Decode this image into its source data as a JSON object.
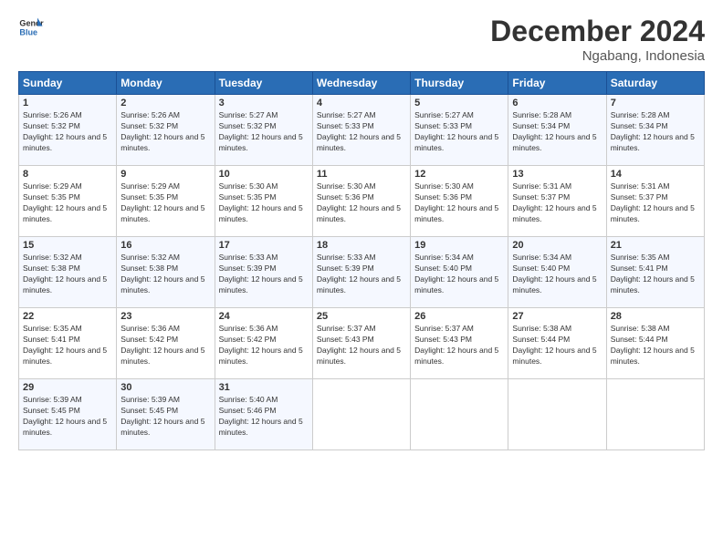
{
  "logo": {
    "line1": "General",
    "line2": "Blue"
  },
  "title": "December 2024",
  "location": "Ngabang, Indonesia",
  "days_of_week": [
    "Sunday",
    "Monday",
    "Tuesday",
    "Wednesday",
    "Thursday",
    "Friday",
    "Saturday"
  ],
  "weeks": [
    [
      {
        "day": "1",
        "sunrise": "5:26 AM",
        "sunset": "5:32 PM",
        "daylight": "12 hours and 5 minutes."
      },
      {
        "day": "2",
        "sunrise": "5:26 AM",
        "sunset": "5:32 PM",
        "daylight": "12 hours and 5 minutes."
      },
      {
        "day": "3",
        "sunrise": "5:27 AM",
        "sunset": "5:32 PM",
        "daylight": "12 hours and 5 minutes."
      },
      {
        "day": "4",
        "sunrise": "5:27 AM",
        "sunset": "5:33 PM",
        "daylight": "12 hours and 5 minutes."
      },
      {
        "day": "5",
        "sunrise": "5:27 AM",
        "sunset": "5:33 PM",
        "daylight": "12 hours and 5 minutes."
      },
      {
        "day": "6",
        "sunrise": "5:28 AM",
        "sunset": "5:34 PM",
        "daylight": "12 hours and 5 minutes."
      },
      {
        "day": "7",
        "sunrise": "5:28 AM",
        "sunset": "5:34 PM",
        "daylight": "12 hours and 5 minutes."
      }
    ],
    [
      {
        "day": "8",
        "sunrise": "5:29 AM",
        "sunset": "5:35 PM",
        "daylight": "12 hours and 5 minutes."
      },
      {
        "day": "9",
        "sunrise": "5:29 AM",
        "sunset": "5:35 PM",
        "daylight": "12 hours and 5 minutes."
      },
      {
        "day": "10",
        "sunrise": "5:30 AM",
        "sunset": "5:35 PM",
        "daylight": "12 hours and 5 minutes."
      },
      {
        "day": "11",
        "sunrise": "5:30 AM",
        "sunset": "5:36 PM",
        "daylight": "12 hours and 5 minutes."
      },
      {
        "day": "12",
        "sunrise": "5:30 AM",
        "sunset": "5:36 PM",
        "daylight": "12 hours and 5 minutes."
      },
      {
        "day": "13",
        "sunrise": "5:31 AM",
        "sunset": "5:37 PM",
        "daylight": "12 hours and 5 minutes."
      },
      {
        "day": "14",
        "sunrise": "5:31 AM",
        "sunset": "5:37 PM",
        "daylight": "12 hours and 5 minutes."
      }
    ],
    [
      {
        "day": "15",
        "sunrise": "5:32 AM",
        "sunset": "5:38 PM",
        "daylight": "12 hours and 5 minutes."
      },
      {
        "day": "16",
        "sunrise": "5:32 AM",
        "sunset": "5:38 PM",
        "daylight": "12 hours and 5 minutes."
      },
      {
        "day": "17",
        "sunrise": "5:33 AM",
        "sunset": "5:39 PM",
        "daylight": "12 hours and 5 minutes."
      },
      {
        "day": "18",
        "sunrise": "5:33 AM",
        "sunset": "5:39 PM",
        "daylight": "12 hours and 5 minutes."
      },
      {
        "day": "19",
        "sunrise": "5:34 AM",
        "sunset": "5:40 PM",
        "daylight": "12 hours and 5 minutes."
      },
      {
        "day": "20",
        "sunrise": "5:34 AM",
        "sunset": "5:40 PM",
        "daylight": "12 hours and 5 minutes."
      },
      {
        "day": "21",
        "sunrise": "5:35 AM",
        "sunset": "5:41 PM",
        "daylight": "12 hours and 5 minutes."
      }
    ],
    [
      {
        "day": "22",
        "sunrise": "5:35 AM",
        "sunset": "5:41 PM",
        "daylight": "12 hours and 5 minutes."
      },
      {
        "day": "23",
        "sunrise": "5:36 AM",
        "sunset": "5:42 PM",
        "daylight": "12 hours and 5 minutes."
      },
      {
        "day": "24",
        "sunrise": "5:36 AM",
        "sunset": "5:42 PM",
        "daylight": "12 hours and 5 minutes."
      },
      {
        "day": "25",
        "sunrise": "5:37 AM",
        "sunset": "5:43 PM",
        "daylight": "12 hours and 5 minutes."
      },
      {
        "day": "26",
        "sunrise": "5:37 AM",
        "sunset": "5:43 PM",
        "daylight": "12 hours and 5 minutes."
      },
      {
        "day": "27",
        "sunrise": "5:38 AM",
        "sunset": "5:44 PM",
        "daylight": "12 hours and 5 minutes."
      },
      {
        "day": "28",
        "sunrise": "5:38 AM",
        "sunset": "5:44 PM",
        "daylight": "12 hours and 5 minutes."
      }
    ],
    [
      {
        "day": "29",
        "sunrise": "5:39 AM",
        "sunset": "5:45 PM",
        "daylight": "12 hours and 5 minutes."
      },
      {
        "day": "30",
        "sunrise": "5:39 AM",
        "sunset": "5:45 PM",
        "daylight": "12 hours and 5 minutes."
      },
      {
        "day": "31",
        "sunrise": "5:40 AM",
        "sunset": "5:46 PM",
        "daylight": "12 hours and 5 minutes."
      },
      null,
      null,
      null,
      null
    ]
  ],
  "labels": {
    "sunrise": "Sunrise:",
    "sunset": "Sunset:",
    "daylight": "Daylight:"
  }
}
